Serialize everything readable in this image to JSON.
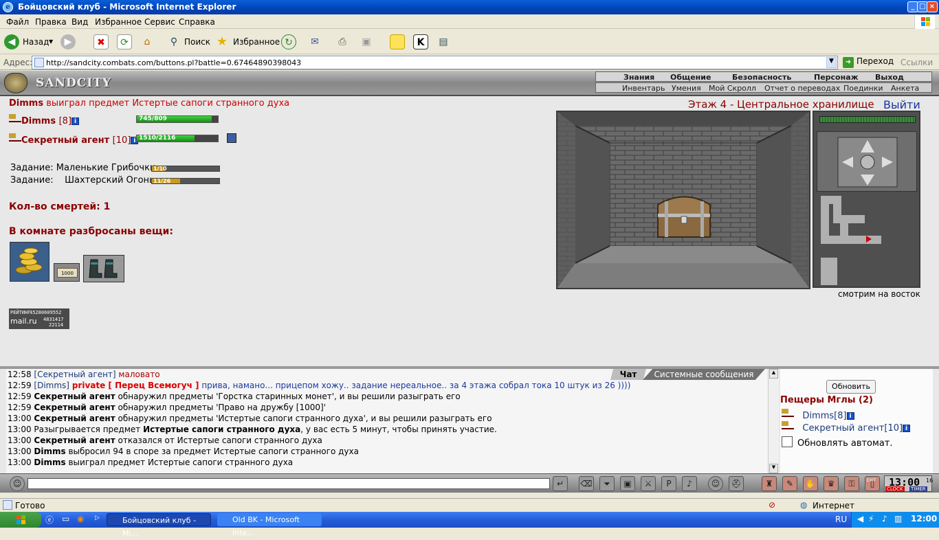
{
  "window": {
    "title": "Бойцовский клуб - Microsoft Internet Explorer"
  },
  "menu": [
    "Файл",
    "Правка",
    "Вид",
    "Избранное",
    "Сервис",
    "Справка"
  ],
  "toolbar": {
    "back_label": "Назад",
    "search_label": "Поиск",
    "favorites_label": "Избранное"
  },
  "address": {
    "label": "Адрес:",
    "url": "http://sandcity.combats.com/buttons.pl?battle=0.67464890398043",
    "go_label": "Переход",
    "links_label": "Ссылки"
  },
  "game": {
    "logo_text": "SANDCITY",
    "nav_top": [
      "Знания",
      "Общение",
      "Безопасность",
      "Персонаж",
      "Выход"
    ],
    "nav_bottom": [
      "Инвентарь",
      "Умения",
      "Мой Скролл",
      "Отчет о переводах",
      "Поединки",
      "Анкета"
    ],
    "win_line": {
      "player": "Dimms",
      "text": " выиграл предмет Истертые сапоги странного духа"
    },
    "players": [
      {
        "name": "Dimms",
        "level": "[8]",
        "hp_text": "745/809",
        "hp_fraction": 0.92
      },
      {
        "name": "Секретный агент",
        "level": "[10]",
        "hp_text": "1510/2116",
        "hp_fraction": 0.71
      }
    ],
    "quests": [
      {
        "label": "Задание:",
        "name": "Маленькие Грибочки",
        "progress_text": "1/10",
        "progress_fraction": 0.1
      },
      {
        "label": "Задание:",
        "name": "Шахтерский Огонь",
        "progress_text": "11/26",
        "progress_fraction": 0.42
      }
    ],
    "deaths": "Кол-во смертей: 1",
    "items_header": "В комнате разбросаны вещи:",
    "scroll_value": "1000",
    "rating": {
      "label": "РЕЙТИНГ",
      "line1": "45280609552",
      "logo": "mail.ru",
      "line2": "4831417",
      "line3": "22114"
    },
    "location": "Этаж 4 - Центральное хранилище",
    "exit_label": "Выйти",
    "facing": "смотрим на восток"
  },
  "chat": {
    "tabs": [
      "Чат",
      "Системные сообщения"
    ],
    "lines": [
      {
        "time": "12:58",
        "sender": "[Секретный агент]",
        "text": " маловато",
        "style": "msg"
      },
      {
        "time": "12:59",
        "sender": "[Dimms]",
        "private": "private [ Перец Всемогуч ]",
        "text": " прива, намано... прицепом хожу.. задание нереальное.. за 4 этажа собрал тока 10 штук из 26 ))))",
        "style": "private"
      },
      {
        "time": "12:59",
        "sender": "Секретный агент",
        "text": " обнаружил предметы 'Горстка старинных монет', и вы решили разыграть его",
        "style": "sys"
      },
      {
        "time": "12:59",
        "sender": "Секретный агент",
        "text": " обнаружил предметы 'Право на дружбу [1000]'",
        "style": "sys"
      },
      {
        "time": "13:00",
        "sender": "Секретный агент",
        "text": " обнаружил предметы 'Истертые сапоги странного духа', и вы решили разыграть его",
        "style": "sys"
      },
      {
        "time": "13:00",
        "sender": "",
        "text": " Разыгрывается предмет ",
        "bold": "Истертые сапоги странного духа",
        "text2": ", у вас есть 5 минут, чтобы принять участие.",
        "style": "sys2"
      },
      {
        "time": "13:00",
        "sender": "Секретный агент",
        "text": " отказался от Истертые сапоги странного духа",
        "style": "sys"
      },
      {
        "time": "13:00",
        "sender": "Dimms",
        "text": " выбросил 94 в споре за предмет Истертые сапоги странного духа",
        "style": "sys"
      },
      {
        "time": "13:00",
        "sender": "Dimms",
        "text": " выиграл предмет Истертые сапоги странного духа",
        "style": "sys"
      }
    ]
  },
  "online": {
    "refresh_label": "Обновить",
    "room": "Пещеры Мглы (2)",
    "users": [
      {
        "name": "Dimms",
        "level": "[8]"
      },
      {
        "name": "Секретный агент",
        "level": "[10]"
      }
    ],
    "auto_label": "Обновлять автомат."
  },
  "clock": {
    "time": "13:00",
    "sec": "16",
    "clock_label": "CLOCK",
    "timer_label": "TIMER",
    "exit_label": "EXIT"
  },
  "status": {
    "left": "Готово",
    "zone": "Интернет"
  },
  "taskbar": {
    "tasks": [
      "Бойцовский клуб - Mi...",
      "Old BK - Microsoft Inte..."
    ],
    "lang": "RU",
    "time": "12:00"
  }
}
